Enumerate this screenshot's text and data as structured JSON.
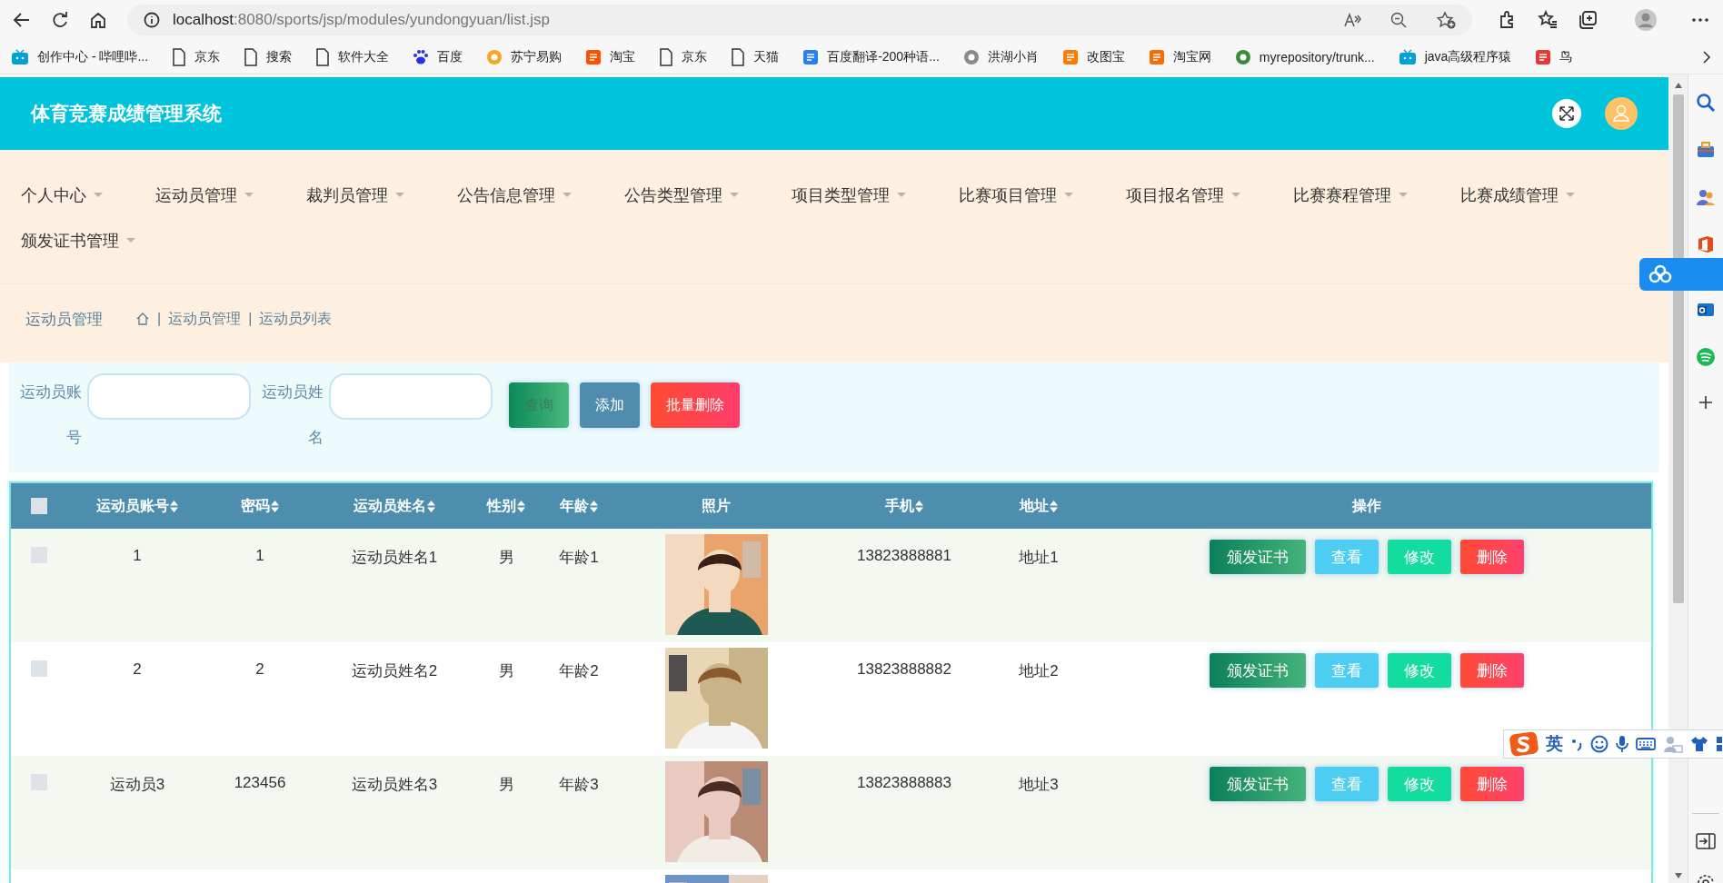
{
  "browser": {
    "url_host": "localhost",
    "url_path": ":8080/sports/jsp/modules/yundongyuan/list.jsp"
  },
  "bookmarks": [
    {
      "label": "创作中心 - 哔哩哔...",
      "kind": "tv",
      "color": "#00a1d6"
    },
    {
      "label": "京东",
      "kind": "page"
    },
    {
      "label": "搜索",
      "kind": "page"
    },
    {
      "label": "软件大全",
      "kind": "page"
    },
    {
      "label": "百度",
      "kind": "paw",
      "color": "#2932e1"
    },
    {
      "label": "苏宁易购",
      "kind": "circle",
      "color": "#f5a623"
    },
    {
      "label": "淘宝",
      "kind": "square",
      "color": "#ff5000"
    },
    {
      "label": "京东",
      "kind": "page"
    },
    {
      "label": "天猫",
      "kind": "page"
    },
    {
      "label": "百度翻译-200种语...",
      "kind": "square",
      "color": "#2b7cf6"
    },
    {
      "label": "洪湖小肖",
      "kind": "circle",
      "color": "#8a8a8a"
    },
    {
      "label": "改图宝",
      "kind": "square",
      "color": "#ff7a00"
    },
    {
      "label": "淘宝网",
      "kind": "square",
      "color": "#ff6a00"
    },
    {
      "label": "myrepository/trunk...",
      "kind": "circle",
      "color": "#3c8b3c"
    },
    {
      "label": "java高级程序猿",
      "kind": "tv",
      "color": "#00a1d6"
    },
    {
      "label": "鸟",
      "kind": "square",
      "color": "#e53935"
    }
  ],
  "header": {
    "title": "体育竞赛成绩管理系统"
  },
  "nav": [
    "个人中心",
    "运动员管理",
    "裁判员管理",
    "公告信息管理",
    "公告类型管理",
    "项目类型管理",
    "比赛项目管理",
    "项目报名管理",
    "比赛赛程管理",
    "比赛成绩管理",
    "颁发证书管理"
  ],
  "breadcrumb": {
    "title": "运动员管理",
    "items": [
      {
        "separator": "|",
        "label": "运动员管理"
      },
      {
        "separator": "|",
        "label": "运动员列表"
      }
    ]
  },
  "search": {
    "fields": [
      {
        "label": "运动员账号"
      },
      {
        "label": "运动员姓名"
      }
    ],
    "buttons": [
      {
        "label": "查询",
        "kind": "search"
      },
      {
        "label": "添加",
        "kind": "add"
      },
      {
        "label": "批量删除",
        "kind": "delete"
      }
    ]
  },
  "table": {
    "select_all": {
      "checked": false
    },
    "columns": [
      {
        "label": "运动员账号",
        "sortable": true
      },
      {
        "label": "密码",
        "sortable": true
      },
      {
        "label": "运动员姓名",
        "sortable": true
      },
      {
        "label": "性别",
        "sortable": true
      },
      {
        "label": "年龄",
        "sortable": true
      },
      {
        "label": "照片",
        "sortable": false
      },
      {
        "label": "手机",
        "sortable": true
      },
      {
        "label": "地址",
        "sortable": true
      },
      {
        "label": "操作",
        "sortable": false
      }
    ],
    "rows": [
      {
        "checked": false,
        "account": "1",
        "password": "1",
        "name": "运动员姓名1",
        "gender": "男",
        "age": "年龄1",
        "photo": {
          "kind": "picture"
        },
        "phone": "13823888881",
        "address": "地址1",
        "actions": [
          {
            "label": "颁发证书",
            "kind": "certificate"
          },
          {
            "label": "查看",
            "kind": "view"
          },
          {
            "label": "修改",
            "kind": "edit"
          },
          {
            "label": "删除",
            "kind": "delete"
          }
        ]
      },
      {
        "checked": false,
        "account": "2",
        "password": "2",
        "name": "运动员姓名2",
        "gender": "男",
        "age": "年龄2",
        "photo": {
          "kind": "picture"
        },
        "phone": "13823888882",
        "address": "地址2",
        "actions": [
          {
            "label": "颁发证书",
            "kind": "certificate"
          },
          {
            "label": "查看",
            "kind": "view"
          },
          {
            "label": "修改",
            "kind": "edit"
          },
          {
            "label": "删除",
            "kind": "delete"
          }
        ]
      },
      {
        "checked": false,
        "account": "运动员3",
        "password": "123456",
        "name": "运动员姓名3",
        "gender": "男",
        "age": "年龄3",
        "photo": {
          "kind": "picture"
        },
        "phone": "13823888883",
        "address": "地址3",
        "actions": [
          {
            "label": "颁发证书",
            "kind": "certificate"
          },
          {
            "label": "查看",
            "kind": "view"
          },
          {
            "label": "修改",
            "kind": "edit"
          },
          {
            "label": "删除",
            "kind": "delete"
          }
        ]
      },
      {
        "photo": {
          "kind": "picture"
        }
      }
    ]
  },
  "ime": {
    "mode": "英"
  }
}
